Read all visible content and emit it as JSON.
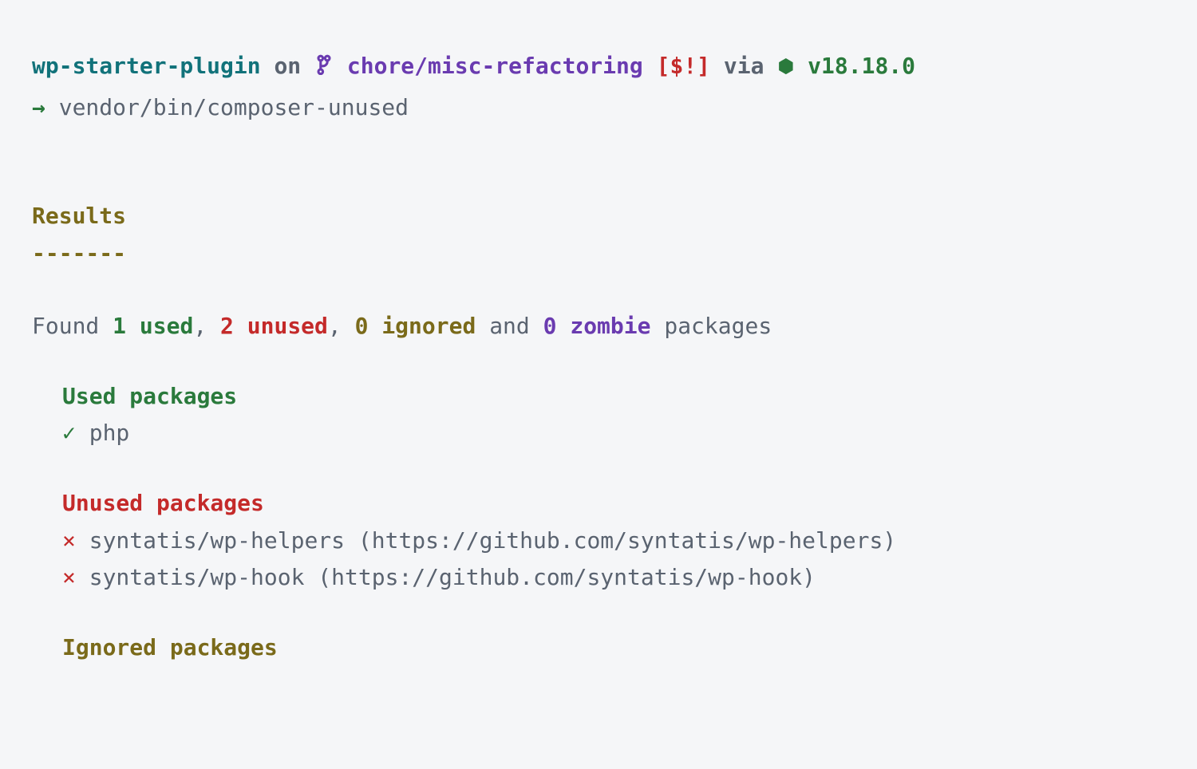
{
  "prompt": {
    "project": "wp-starter-plugin",
    "on": "on",
    "branch": "chore/misc-refactoring",
    "status": "[$!]",
    "via": "via",
    "version": "v18.18.0",
    "arrow": "→",
    "command": "vendor/bin/composer-unused"
  },
  "results": {
    "heading": "Results",
    "divider": "-------"
  },
  "summary": {
    "found": "Found",
    "used_count": "1 used",
    "sep1": ",",
    "unused_count": "2 unused",
    "sep2": ",",
    "ignored_count": "0 ignored",
    "and": "and",
    "zombie_count": "0 zombie",
    "packages": "packages"
  },
  "used": {
    "heading": "Used packages",
    "items": [
      {
        "mark": "✓",
        "name": "php"
      }
    ]
  },
  "unused": {
    "heading": "Unused packages",
    "items": [
      {
        "mark": "×",
        "name": "syntatis/wp-helpers (https://github.com/syntatis/wp-helpers)"
      },
      {
        "mark": "×",
        "name": "syntatis/wp-hook (https://github.com/syntatis/wp-hook)"
      }
    ]
  },
  "ignored": {
    "heading": "Ignored packages"
  }
}
